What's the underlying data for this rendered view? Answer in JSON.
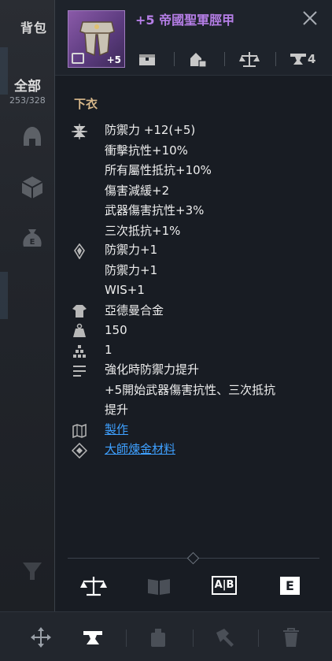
{
  "sidebar": {
    "title": "背包",
    "category": "全部",
    "count": "253/328",
    "icons": [
      "helmet-icon",
      "cube-icon",
      "money-bag-icon",
      "filter-icon"
    ]
  },
  "item": {
    "name": "+5 帝國聖軍脛甲",
    "enhance_badge": "+5",
    "name_color": "#b57ee6",
    "header_count": "4",
    "slot": "下衣"
  },
  "stats": {
    "base": [
      "防禦力 +12(+5)",
      "衝擊抗性+10%",
      "所有屬性抵抗+10%",
      "傷害減緩+2",
      "武器傷害抗性+3%",
      "三次抵抗+1%"
    ],
    "bonus": [
      "防禦力+1",
      "防禦力+1",
      "WIS+1"
    ],
    "material": "亞德曼合金",
    "weight": "150",
    "tier": "1",
    "description": [
      "強化時防禦力提升",
      "+5開始武器傷害抗性、三次抵抗",
      "提升"
    ],
    "craft_link": "製作",
    "alchemy_link": "大師煉金材料"
  },
  "bottom_icons": {
    "compare_label": "A|B",
    "e_label": "E"
  },
  "colors": {
    "link": "#3ea0ff",
    "slot": "#d9b98b",
    "panel_bg": "#181c23"
  }
}
